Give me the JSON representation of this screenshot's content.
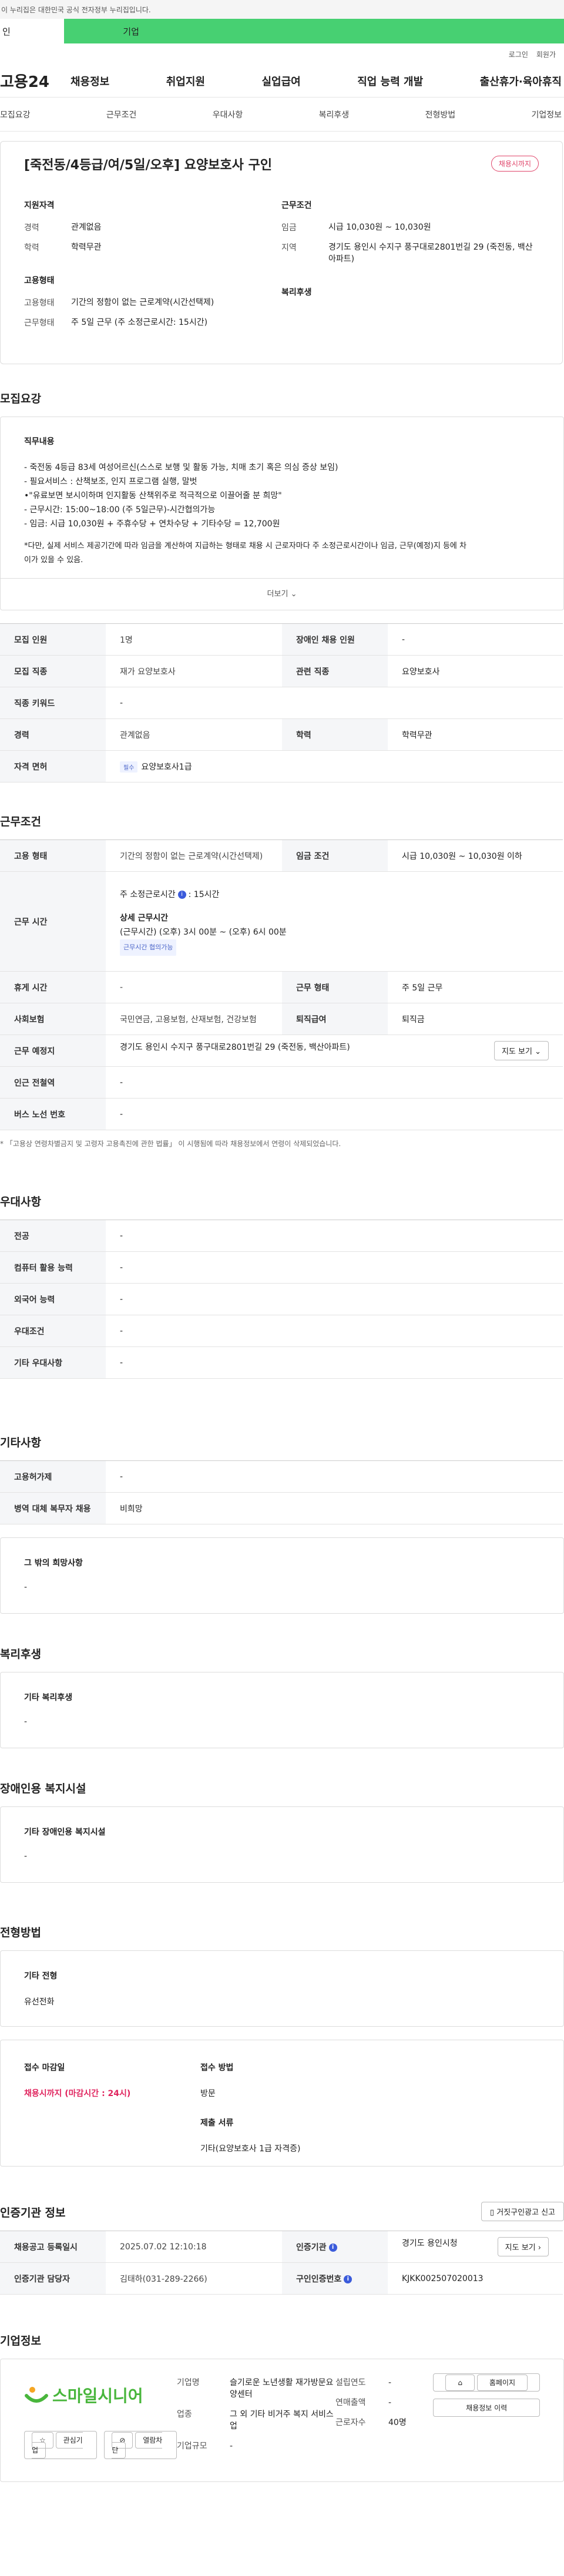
{
  "gov_banner": "이 누리집은 대한민국 공식 전자정부 누리집입니다.",
  "tabs": [
    "인",
    "기업"
  ],
  "util": [
    "로그인",
    "회원가"
  ],
  "logo": "고용24",
  "gnb": [
    "채용정보",
    "취업지원",
    "실업급여",
    "직업 능력 개발",
    "출산휴가·육아휴직"
  ],
  "subnav": [
    "모집요강",
    "근무조건",
    "우대사항",
    "복리후생",
    "전형방법",
    "기업정보"
  ],
  "header": {
    "title": "[죽전동/4등급/여/5일/오후] 요양보호사 구인",
    "badge": "채용시까지",
    "qual_title": "지원자격",
    "career_k": "경력",
    "career_v": "관계없음",
    "edu_k": "학력",
    "edu_v": "학력무관",
    "cond_title": "근무조건",
    "wage_k": "임금",
    "wage_v": "시급 10,030원 ~ 10,030원",
    "area_k": "지역",
    "area_v": "경기도 용인시 수지구 풍구대로2801번길 29 (죽전동, 백산아파트)",
    "emp_title": "고용형태",
    "type_k": "고용형태",
    "type_v": "기간의 정함이 없는 근로계약(시간선택제)",
    "work_k": "근무형태",
    "work_v": "주 5일 근무 (주 소정근로시간: 15시간)",
    "welfare_title": "복리후생"
  },
  "recruit": {
    "section_title": "모집요강",
    "jd_title": "직무내용",
    "jd_lines": [
      "- 죽전동 4등급 83세 여성어르신(스스로 보행 및 활동 가능, 치매 초기 혹은 의심 증상 보임)",
      "- 필요서비스 : 산책보조, 인지 프로그램 실행, 말벗",
      "•\"유료보면 보시이하며 인지활동 산책위주로 적극적으로 이끌어줄 분 희망\"",
      "- 근무시간: 15:00~18:00 (주 5일근무)-시간협의가능",
      "- 임금: 시급 10,030원 + 주휴수당 + 연차수당 + 기타수당 = 12,700원",
      "",
      "*다만, 실제 서비스 제공기간에 따라 임금을 계산하여 지급하는 형태로 채용 시 근로자마다 주 소정근로시간이나 임금,  근무(예정)지 등에 차",
      "이가 있을 수 있음."
    ],
    "more": "더보기",
    "rows": {
      "count_k": "모집 인원",
      "count_v": "1명",
      "disabled_k": "장애인 채용 인원",
      "disabled_v": "-",
      "job_k": "모집 직종",
      "job_v": "재가 요양보호사",
      "related_k": "관련 직종",
      "related_v": "요양보호사",
      "keyword_k": "직종 키워드",
      "keyword_v": "-",
      "career_k": "경력",
      "career_v": "관계없음",
      "edu_k": "학력",
      "edu_v": "학력무관",
      "license_k": "자격 면허",
      "license_tag": "필수",
      "license_v": "요양보호사1급"
    }
  },
  "conditions": {
    "section_title": "근무조건",
    "type_k": "고용 형태",
    "type_v": "기간의 정함이 없는 근로계약(시간선택제)",
    "wage_k": "임금 조건",
    "wage_v": "시급 10,030원 ~ 10,030원 이하",
    "hours_k": "근무 시간",
    "hours_weekly": "주 소정근로시간",
    "hours_weekly_v": ": 15시간",
    "hours_detail_title": "상세 근무시간",
    "hours_detail": "(근무시간) (오후) 3시 00분 ~ (오후) 6시 00분",
    "hours_tag": "근무시간 협의가능",
    "break_k": "휴게 시간",
    "break_v": "-",
    "form_k": "근무 형태",
    "form_v": "주 5일 근무",
    "ins_k": "사회보험",
    "ins_v": "국민연금, 고용보험, 산재보험, 건강보험",
    "severance_k": "퇴직급여",
    "severance_v": "퇴직금",
    "place_k": "근무 예정지",
    "place_v": "경기도 용인시 수지구 풍구대로2801번길 29 (죽전동, 백산아파트)",
    "map_btn": "지도 보기",
    "subway_k": "인근 전철역",
    "subway_v": "-",
    "bus_k": "버스 노선 번호",
    "bus_v": "-",
    "footnote": "* 「고용상 연령차별금지 및 고령자 고용촉진에 관한 법률」 이 시행됨에 따라 채용정보에서 연령이 삭제되었습니다."
  },
  "preference": {
    "section_title": "우대사항",
    "rows": [
      {
        "k": "전공",
        "v": "-"
      },
      {
        "k": "컴퓨터 활용 능력",
        "v": "-"
      },
      {
        "k": "외국어 능력",
        "v": "-"
      },
      {
        "k": "우대조건",
        "v": "-"
      },
      {
        "k": "기타 우대사항",
        "v": "-"
      }
    ]
  },
  "other": {
    "section_title": "기타사항",
    "rows": [
      {
        "k": "고용허가제",
        "v": "-"
      },
      {
        "k": "병역 대체 복무자 채용",
        "v": "비희망"
      }
    ],
    "box_title": "그 밖의 희망사항",
    "box_v": "-"
  },
  "welfare": {
    "section_title": "복리후생",
    "box_title": "기타 복리후생",
    "box_v": "-"
  },
  "facility": {
    "section_title": "장애인용 복지시설",
    "box_title": "기타 장애인용 복지시설",
    "box_v": "-"
  },
  "process": {
    "section_title": "전형방법",
    "box_title": "기타 전형",
    "box_v": "유선전화",
    "deadline_title": "접수 마감일",
    "deadline_v": "채용시까지 (마감시간 : 24시)",
    "method_title": "접수 방법",
    "method_v": "방문",
    "docs_title": "제출 서류",
    "docs_v": "기타(요양보호사 1급 자격증)"
  },
  "agency": {
    "section_title": "인증기관 정보",
    "report_btn": "거짓구인광고 신고",
    "date_k": "채용공고 등록일시",
    "date_v": "2025.07.02 12:10:18",
    "agency_k": "인증기관",
    "agency_v": "경기도 용인시청",
    "map_btn": "지도 보기",
    "manager_k": "인증기관 담당자",
    "manager_v": "김태하(031-289-2266)",
    "id_k": "구인인증번호",
    "id_v": "KJKK002507020013"
  },
  "company": {
    "section_title": "기업정보",
    "logo": "스마일시니어",
    "interest_btn": "관심기업",
    "block_btn": "열람차단",
    "name_k": "기업명",
    "name_v": "슬기로운 노년생활 재가방문요양센터",
    "industry_k": "업종",
    "industry_v": "그 외 기타 비거주 복지 서비스업",
    "size_k": "기업규모",
    "size_v": "-",
    "founded_k": "설립연도",
    "founded_v": "-",
    "sales_k": "연매출액",
    "sales_v": "-",
    "staff_k": "근로자수",
    "staff_v": "40명",
    "homepage_btn": "홈페이지",
    "history_btn": "채용정보 이력"
  }
}
